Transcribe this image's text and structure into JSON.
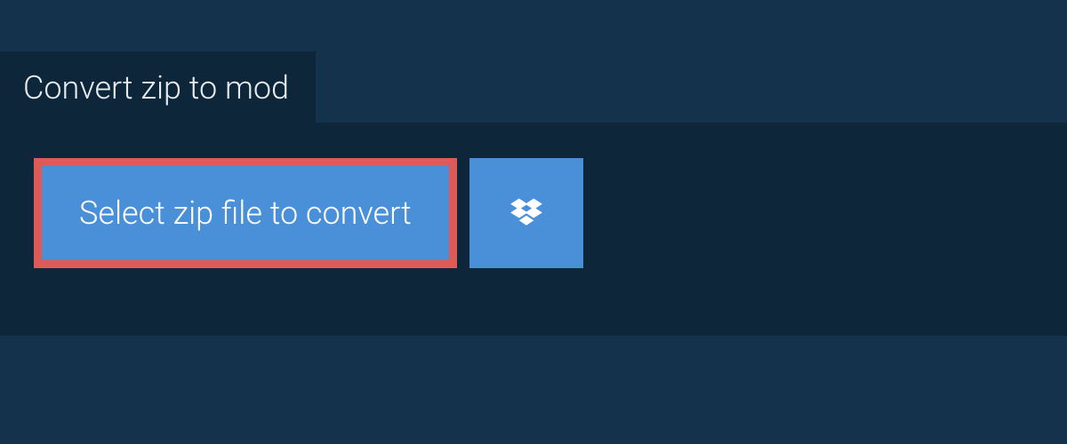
{
  "tab": {
    "label": "Convert zip to mod"
  },
  "actions": {
    "select_label": "Select zip file to convert"
  },
  "colors": {
    "page_bg": "#14324b",
    "panel_bg": "#0d263a",
    "button_bg": "#4a90d9",
    "highlight_border": "#de5a56",
    "text_light": "#e8edf2",
    "text_white": "#ffffff"
  }
}
